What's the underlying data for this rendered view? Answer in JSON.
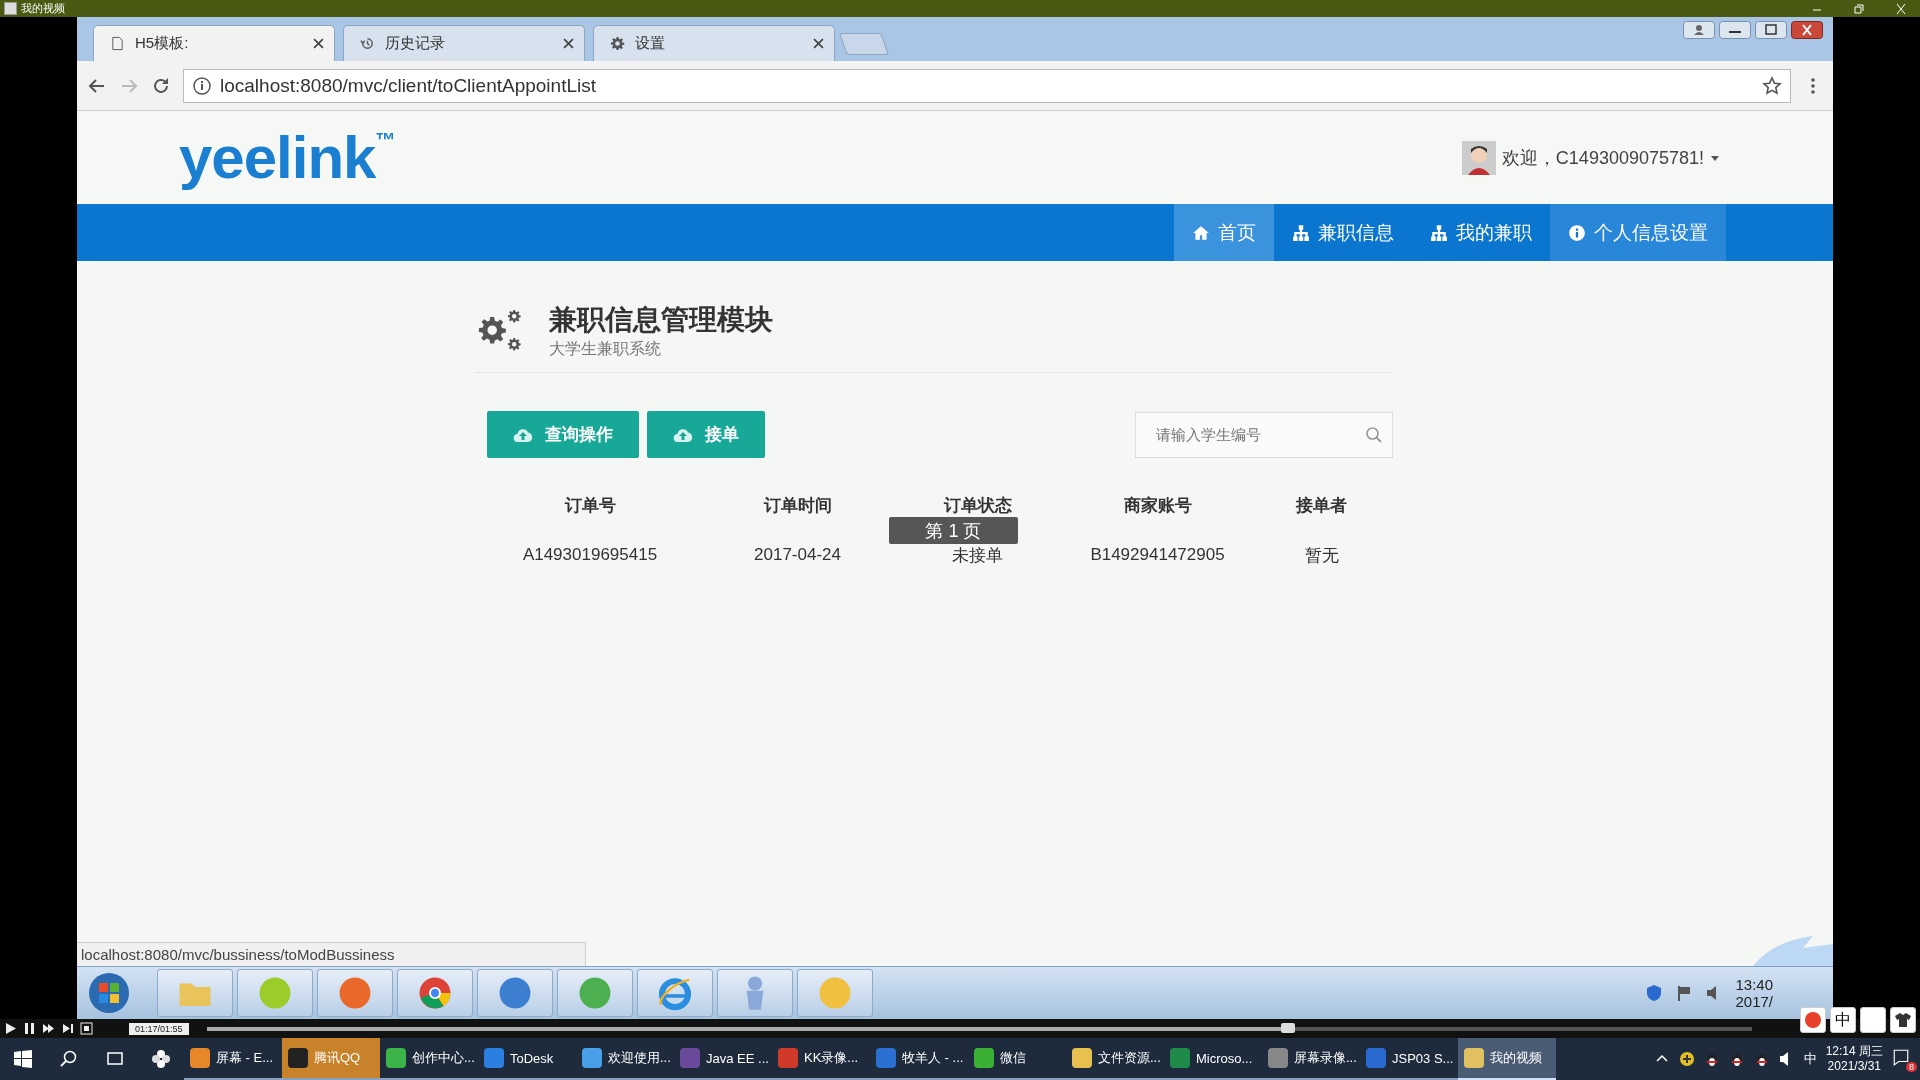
{
  "player_window": {
    "title": "我的视频"
  },
  "browser": {
    "tabs": [
      {
        "label": "H5模板:",
        "kind": "page",
        "selected": true
      },
      {
        "label": "历史记录",
        "kind": "history",
        "selected": false
      },
      {
        "label": "设置",
        "kind": "gear",
        "selected": false
      }
    ],
    "address_bar": {
      "url": "localhost:8080/mvc/client/toClientAppointList"
    },
    "status_url": "localhost:8080/mvc/bussiness/toModBussiness"
  },
  "site": {
    "logo": "yeelink",
    "logo_mark": "™",
    "user_greeting": "欢迎，C1493009075781!",
    "nav": [
      {
        "label": "首页",
        "kind": "home",
        "selected": true,
        "hovered": false
      },
      {
        "label": "兼职信息",
        "kind": "sitemap",
        "selected": false,
        "hovered": false
      },
      {
        "label": "我的兼职",
        "kind": "sitemap",
        "selected": false,
        "hovered": false
      },
      {
        "label": "个人信息设置",
        "kind": "info",
        "selected": false,
        "hovered": true
      }
    ]
  },
  "module": {
    "title": "兼职信息管理模块",
    "subtitle": "大学生兼职系统",
    "buttons": [
      "查询操作",
      "接单"
    ],
    "search": {
      "placeholder": "请输入学生编号"
    }
  },
  "table": {
    "columns": [
      "订单号",
      "订单时间",
      "订单状态",
      "商家账号",
      "接单者"
    ],
    "rows": [
      [
        "A1493019695415",
        "2017-04-24",
        "未接单",
        "B1492941472905",
        "暂无"
      ]
    ]
  },
  "toast": "第 1 页",
  "recorded_taskbar": {
    "apps": [
      {
        "kind": "folder",
        "color": "#e8c45a"
      },
      {
        "kind": "circle",
        "color": "#9ccc2a"
      },
      {
        "kind": "circle",
        "color": "#e8692a"
      },
      {
        "kind": "chrome",
        "color": "#db4437"
      },
      {
        "kind": "circle",
        "color": "#3c7fd0"
      },
      {
        "kind": "circle",
        "color": "#4caf50"
      },
      {
        "kind": "ie",
        "color": "#2a8de0"
      },
      {
        "kind": "figure",
        "color": "#8aa8d8"
      },
      {
        "kind": "circle",
        "color": "#f0c040"
      }
    ],
    "clock": {
      "time": "13:40",
      "date": "2017/"
    }
  },
  "ime_toolbar": {
    "mode": "中"
  },
  "player_controls": {
    "time": "01:17/01:55",
    "level": 0.7
  },
  "taskbar": {
    "items": [
      {
        "label": "屏幕 - E...",
        "color": "#e8862a",
        "selected": false,
        "flashing": false
      },
      {
        "label": "腾讯QQ",
        "color": "#222222",
        "selected": false,
        "flashing": true
      },
      {
        "label": "创作中心...",
        "color": "#3cb44a",
        "selected": false,
        "flashing": false
      },
      {
        "label": "ToDesk",
        "color": "#2a7fe0",
        "selected": false,
        "flashing": false
      },
      {
        "label": "欢迎使用...",
        "color": "#4aa0e8",
        "selected": false,
        "flashing": false
      },
      {
        "label": "Java EE ...",
        "color": "#6a4a9a",
        "selected": false,
        "flashing": false
      },
      {
        "label": "KK录像...",
        "color": "#d03a2a",
        "selected": false,
        "flashing": false
      },
      {
        "label": "牧羊人 - ...",
        "color": "#2a70d0",
        "selected": false,
        "flashing": false
      },
      {
        "label": "微信",
        "color": "#3cb034",
        "selected": false,
        "flashing": false
      },
      {
        "label": "文件资源...",
        "color": "#e8c050",
        "selected": false,
        "flashing": false
      },
      {
        "label": "Microso...",
        "color": "#1f8a4a",
        "selected": false,
        "flashing": false
      },
      {
        "label": "屏幕录像...",
        "color": "#888888",
        "selected": false,
        "flashing": false
      },
      {
        "label": "JSP03 S...",
        "color": "#2a6ad0",
        "selected": false,
        "flashing": false
      },
      {
        "label": "我的视频",
        "color": "#e0c060",
        "selected": true,
        "flashing": false
      }
    ],
    "input_method": "中",
    "clock": {
      "time": "12:14 周三",
      "date": "2021/3/31"
    },
    "notifications": "8"
  }
}
